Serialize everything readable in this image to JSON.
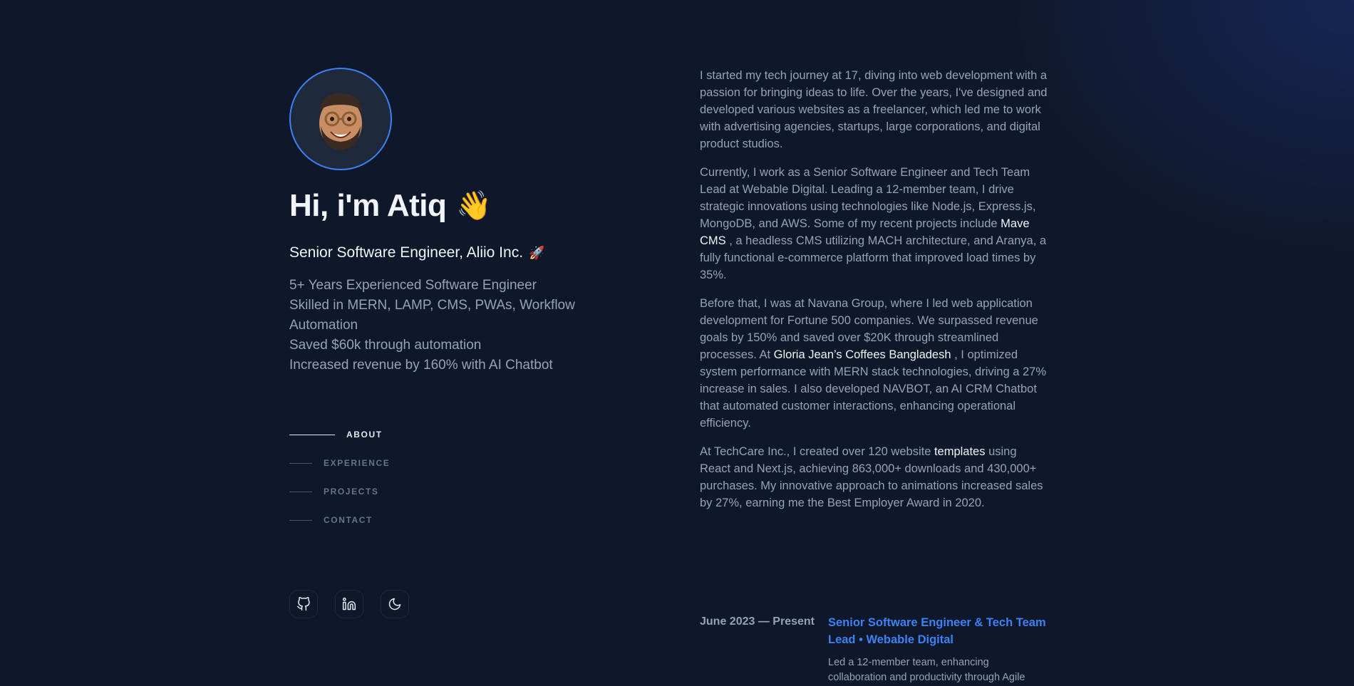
{
  "colors": {
    "background": "#0f172a",
    "accent": "#3b82f6",
    "heading": "#f1f5f9",
    "muted": "#94a3b8"
  },
  "profile": {
    "avatar_icon": "memoji-avatar",
    "greeting": "Hi, i'm Atiq",
    "wave_emoji": "👋",
    "role": "Senior Software Engineer, Aliio Inc.",
    "role_emoji": "🚀",
    "bullets": [
      "5+ Years Experienced Software Engineer",
      "Skilled in MERN, LAMP, CMS, PWAs, Workflow Automation",
      "Saved $60k through automation",
      "Increased revenue by 160% with AI Chatbot"
    ]
  },
  "nav": {
    "items": [
      {
        "label": "ABOUT",
        "active": true
      },
      {
        "label": "EXPERIENCE",
        "active": false
      },
      {
        "label": "PROJECTS",
        "active": false
      },
      {
        "label": "CONTACT",
        "active": false
      }
    ]
  },
  "socials": [
    {
      "icon": "github-icon"
    },
    {
      "icon": "linkedin-icon"
    },
    {
      "icon": "moon-icon"
    }
  ],
  "about": {
    "p1": "I started my tech journey at 17, diving into web development with a passion for bringing ideas to life. Over the years, I've designed and developed various websites as a freelancer, which led me to work with advertising agencies, startups, large corporations, and digital product studios.",
    "p2_a": "Currently, I work as a Senior Software Engineer and Tech Team Lead at Webable Digital. Leading a 12-member team, I drive strategic innovations using technologies like Node.js, Express.js, MongoDB, and AWS. Some of my recent projects include ",
    "p2_link": "Mave CMS",
    "p2_b": " , a headless CMS utilizing MACH architecture, and Aranya, a fully functional e-commerce platform that improved load times by 35%.",
    "p3_a": "Before that, I was at Navana Group, where I led web application development for Fortune 500 companies. We surpassed revenue goals by 150% and saved over $20K through streamlined processes. At ",
    "p3_link": "Gloria Jean’s Coffees Bangladesh",
    "p3_b": " , I optimized system performance with MERN stack technologies, driving a 27% increase in sales. I also developed NAVBOT, an AI CRM Chatbot that automated customer interactions, enhancing operational efficiency.",
    "p4_a": "At TechCare Inc., I created over 120 website ",
    "p4_link": "templates",
    "p4_b": " using React and Next.js, achieving 863,000+ downloads and 430,000+ purchases. My innovative approach to animations increased sales by 27%, earning me the Best Employer Award in 2020."
  },
  "experience": [
    {
      "date": "June 2023 — Present",
      "title": "Senior Software Engineer & Tech Team Lead • Webable Digital",
      "description": "Led a 12-member team, enhancing collaboration and productivity through Agile"
    }
  ]
}
